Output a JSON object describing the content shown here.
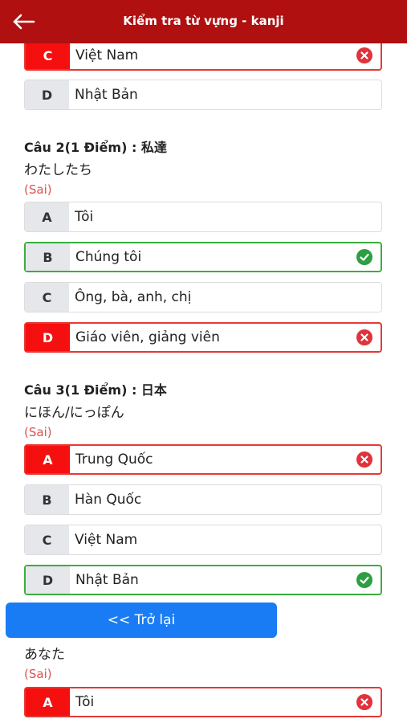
{
  "header": {
    "title": "Kiểm tra từ vựng - kanji",
    "back_icon": "arrow-left-icon"
  },
  "q1_tail": {
    "options": [
      {
        "letter": "C",
        "text": "Việt Nam",
        "state": "wrong"
      },
      {
        "letter": "D",
        "text": "Nhật Bản",
        "state": "normal"
      }
    ]
  },
  "q2": {
    "title": "Câu 2(1 Điểm) : 私達",
    "kana": "わたしたち",
    "status": "(Sai)",
    "options": [
      {
        "letter": "A",
        "text": "Tôi",
        "state": "normal"
      },
      {
        "letter": "B",
        "text": "Chúng tôi",
        "state": "correct"
      },
      {
        "letter": "C",
        "text": "Ông, bà, anh, chị",
        "state": "normal"
      },
      {
        "letter": "D",
        "text": "Giáo viên, giảng viên",
        "state": "wrong"
      }
    ]
  },
  "q3": {
    "title": "Câu 3(1 Điểm) : 日本",
    "kana": "にほん/にっぽん",
    "status": "(Sai)",
    "options": [
      {
        "letter": "A",
        "text": "Trung Quốc",
        "state": "wrong"
      },
      {
        "letter": "B",
        "text": "Hàn Quốc",
        "state": "normal"
      },
      {
        "letter": "C",
        "text": "Việt Nam",
        "state": "normal"
      },
      {
        "letter": "D",
        "text": "Nhật Bản",
        "state": "correct"
      }
    ]
  },
  "q4": {
    "kana": "あなた",
    "status": "(Sai)",
    "options": [
      {
        "letter": "A",
        "text": "Tôi",
        "state": "wrong"
      }
    ]
  },
  "back_button": {
    "label": "<< Trở lại"
  },
  "colors": {
    "header": "#b01010",
    "wrong": "#e53935",
    "correct": "#3cae3c",
    "button": "#1a7cf5",
    "status": "#d9534f"
  }
}
